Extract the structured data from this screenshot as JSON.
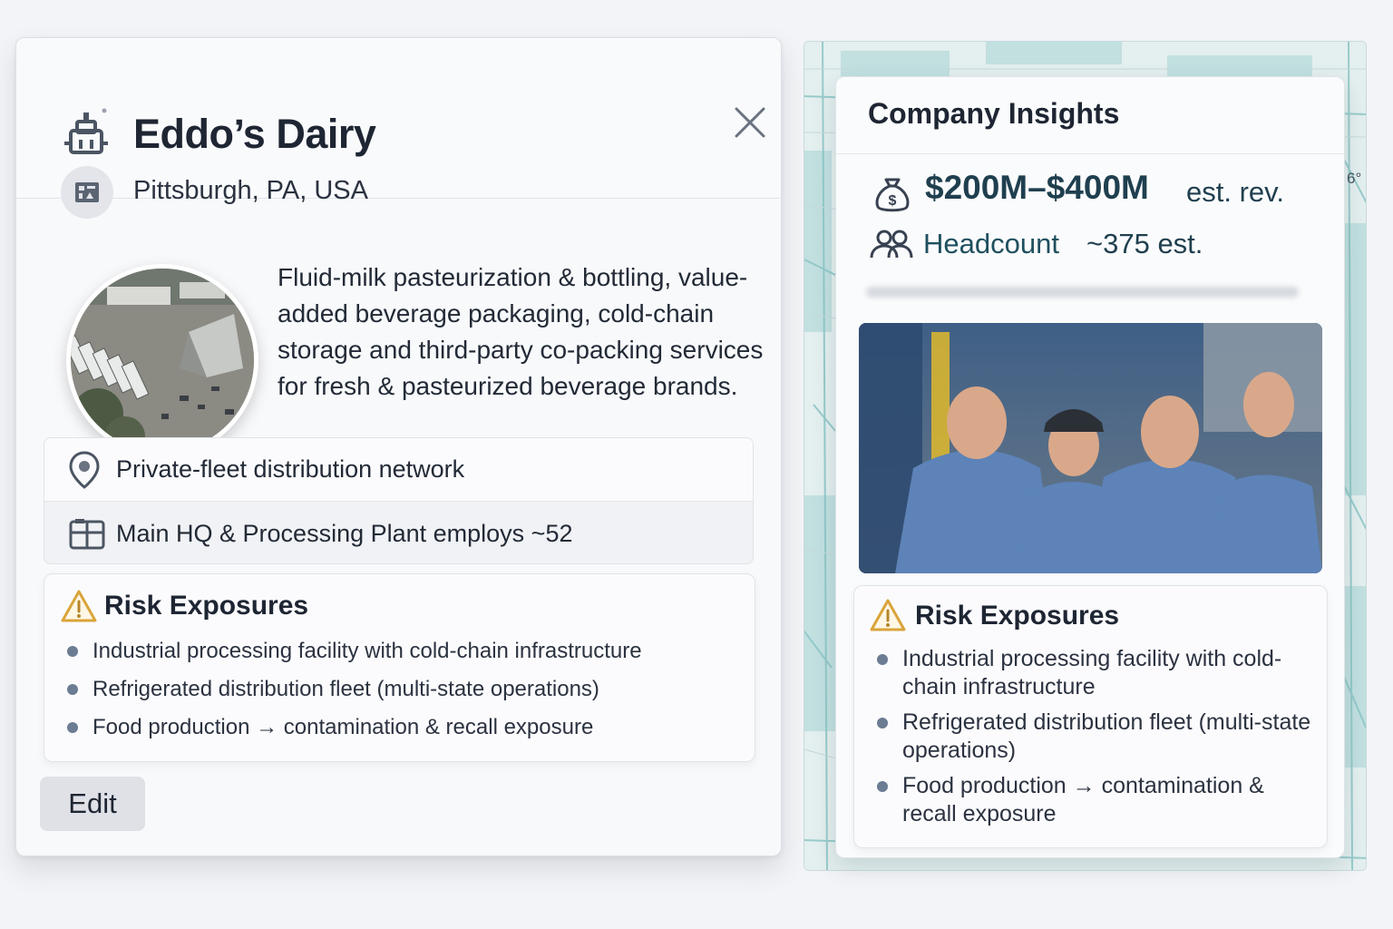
{
  "company": {
    "name": "Eddo’s Dairy",
    "location": "Pittsburgh, PA, USA",
    "description": "Fluid-milk pasteurization & bottling, value-added beverage packaging, cold-chain storage and third-party co-packing services for fresh & pasteurized beverage brands.",
    "info_rows": [
      {
        "icon": "map-pin-icon",
        "text": "Private-fleet distribution network"
      },
      {
        "icon": "building-icon",
        "text": "Main HQ & Processing Plant employs ~52"
      }
    ],
    "risk": {
      "title": "Risk Exposures",
      "items": [
        "Industrial processing facility with cold-chain infrastructure",
        "Refrigerated distribution fleet (multi-state operations)",
        "Food production → contamination & recall exposure"
      ]
    },
    "edit_label": "Edit"
  },
  "insights": {
    "title": "Company Insights",
    "revenue_value": "$200M–$400M",
    "revenue_suffix": "est. rev.",
    "headcount_label": "Headcount",
    "headcount_value": "~375 est.",
    "map_label": "6°",
    "risk": {
      "title": "Risk Exposures",
      "items": [
        "Industrial processing facility with cold-chain infrastructure",
        "Refrigerated distribution fleet (multi-state operations)",
        "Food production → contamination & recall exposure"
      ]
    }
  },
  "colors": {
    "accent_teal": "#1f4f5f",
    "warning": "#d9a43a",
    "map_water": "#a9d3d4"
  }
}
